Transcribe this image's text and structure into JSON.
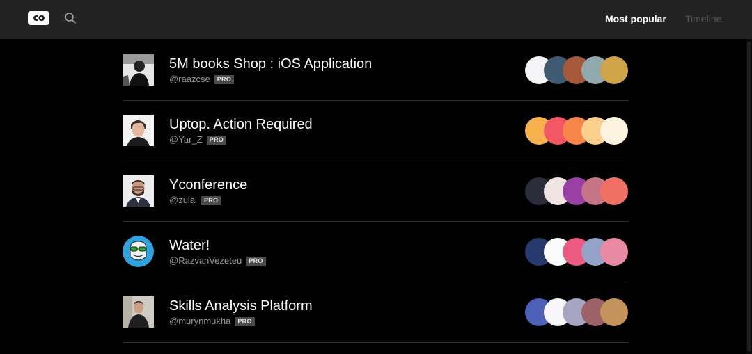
{
  "header": {
    "logo_text": "co",
    "search_icon": "search-icon",
    "nav": {
      "most_popular": "Most popular",
      "timeline": "Timeline"
    },
    "active_tab": "Most popular"
  },
  "palettes": [
    {
      "title": "5M books Shop : iOS Application",
      "handle": "@raazcse",
      "badge": "PRO",
      "avatar": "avatar-bw-portrait",
      "colors": [
        "#f5f5f7",
        "#3f5b73",
        "#a6583a",
        "#90a9ac",
        "#d0a449"
      ]
    },
    {
      "title": "Uptop. Action Required",
      "handle": "@Yar_Z",
      "badge": "PRO",
      "avatar": "avatar-portrait",
      "colors": [
        "#f7b24e",
        "#f25763",
        "#f7864a",
        "#fbd08d",
        "#fcf3e1"
      ]
    },
    {
      "title": "Yconference",
      "handle": "@zulal",
      "badge": "PRO",
      "avatar": "avatar-portrait",
      "colors": [
        "#2c2d3b",
        "#f0e4e3",
        "#9a3fa3",
        "#c57586",
        "#f07163"
      ]
    },
    {
      "title": "Water!",
      "handle": "@RazvanVezeteu",
      "badge": "PRO",
      "avatar": "avatar-illustration",
      "colors": [
        "#273a6e",
        "#fbfbfb",
        "#ee5b82",
        "#94a2c8",
        "#e88aa4"
      ]
    },
    {
      "title": "Skills Analysis Platform",
      "handle": "@murynmukha",
      "badge": "PRO",
      "avatar": "avatar-portrait",
      "colors": [
        "#4e61b9",
        "#f6f6f8",
        "#a7a6c2",
        "#9d6168",
        "#c4935b"
      ]
    }
  ]
}
